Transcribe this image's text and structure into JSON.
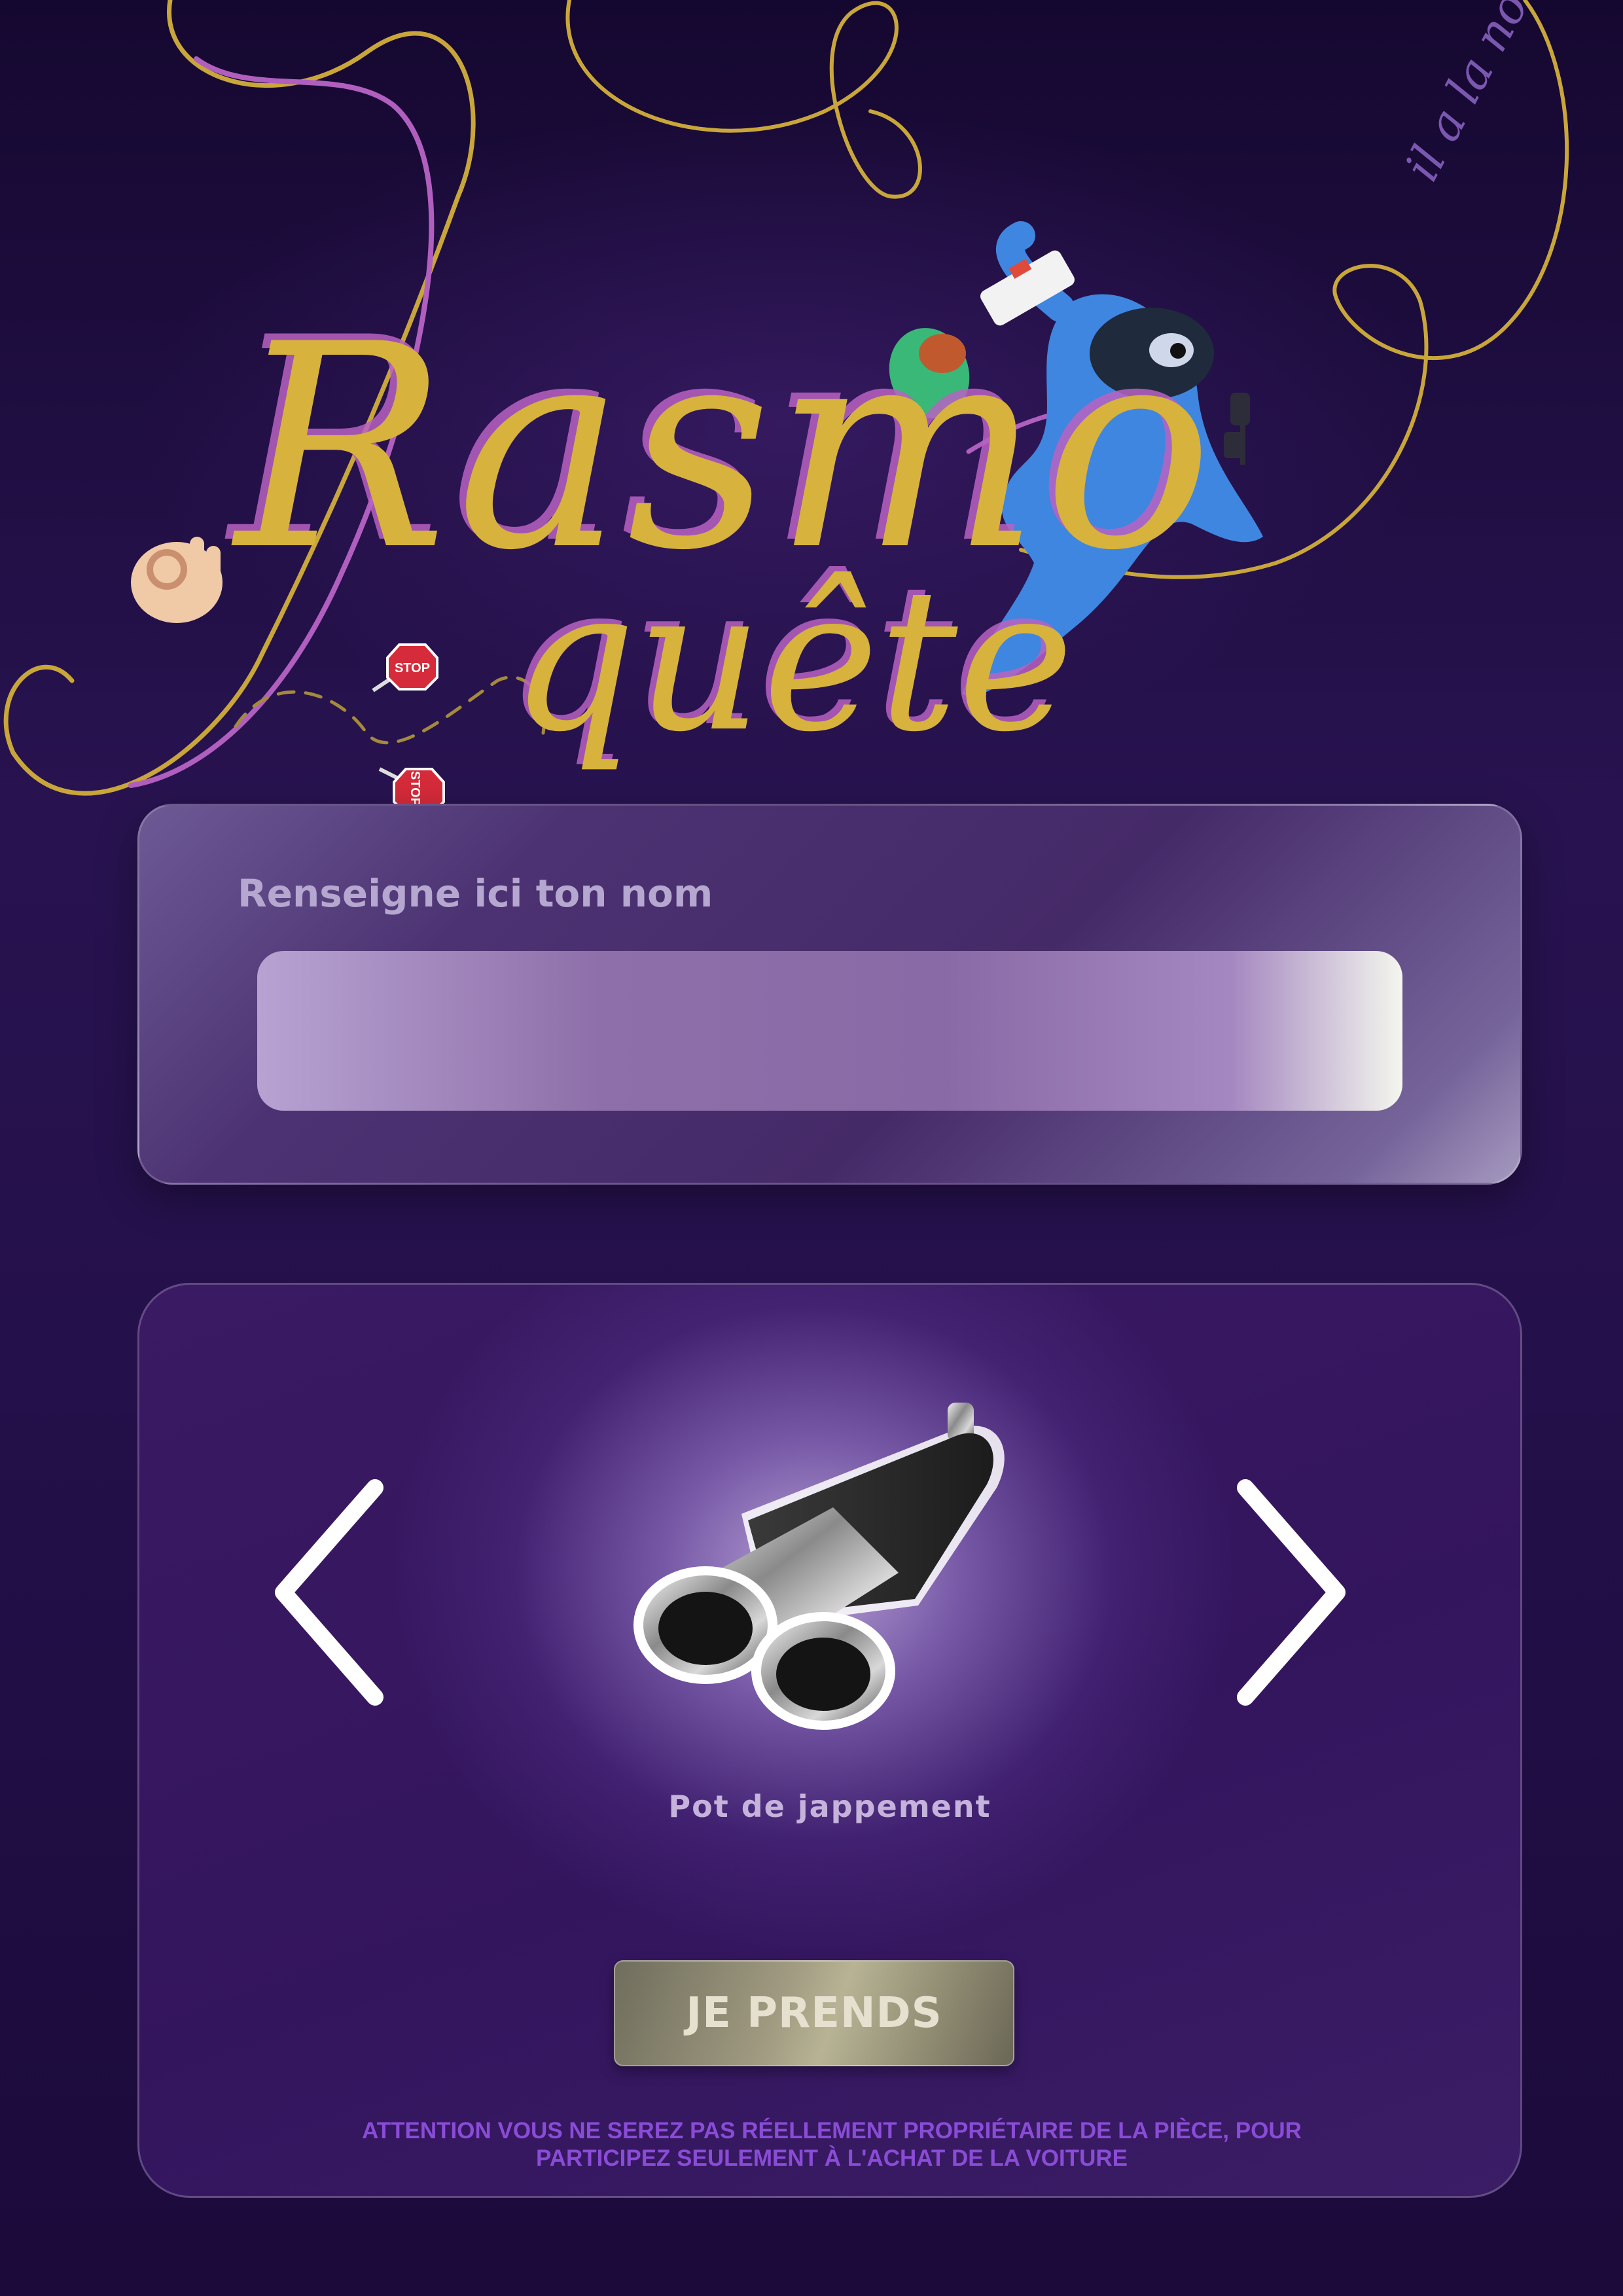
{
  "hero": {
    "title_main": "Rasmo",
    "title_sub": "quête",
    "tagline": "il a la note $",
    "stop_sign_label": "STOP",
    "icons": [
      "ok-hand-icon",
      "stop-sign-icon",
      "running-mechanic-character"
    ]
  },
  "name_form": {
    "label": "Renseigne ici ton nom",
    "input_value": "",
    "input_placeholder": ""
  },
  "product": {
    "name": "Pot de jappement",
    "image_icon": "exhaust-muffler-icon",
    "prev_icon": "chevron-left-icon",
    "next_icon": "chevron-right-icon",
    "take_button_label": "JE PRENDS",
    "disclaimer_line1": "ATTENTION VOUS NE SEREZ PAS RÉELLEMENT PROPRIÉTAIRE DE LA PIÈCE, POUR",
    "disclaimer_line2": "PARTICIPEZ SEULEMENT À L'ACHAT DE LA VOITURE"
  },
  "colors": {
    "background": "#1e0d3d",
    "title_gold": "#d7b23c",
    "title_pink": "#b862c2",
    "disclaimer": "#8a4cd6",
    "character_blue": "#3f86e0"
  }
}
